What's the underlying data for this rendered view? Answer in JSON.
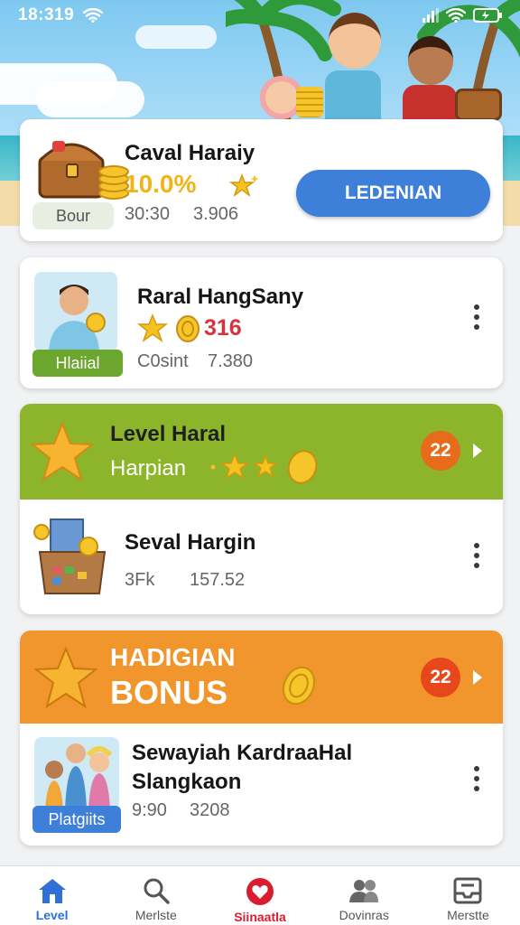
{
  "status_bar": {
    "time": "18:319"
  },
  "card1": {
    "title": "Caval Haraiy",
    "percent": "10.0%",
    "chip": "Bour",
    "meta_a": "30:30",
    "meta_b": "3.906",
    "button": "LEDENIAN"
  },
  "card2": {
    "title": "Raral HangSany",
    "number": "316",
    "chip": "Hlaiial",
    "meta_a": "C0sint",
    "meta_b": "7.380"
  },
  "card3": {
    "banner_title": "Level Haral",
    "banner_sub": "Harpian",
    "badge": "22",
    "item_title": "Seval Hargin",
    "meta_a": "3Fk",
    "meta_b": "157.52"
  },
  "card4": {
    "banner_line1": "HADIGIAN",
    "banner_line2": "BONUS",
    "badge": "22",
    "item_title_1": "Sewayiah KardraaHal",
    "item_title_2": "Slangkaon",
    "chip": "Platgiits",
    "meta_a": "9:90",
    "meta_b": "3208"
  },
  "tabs": [
    {
      "label": "Level",
      "color": "#2f6fd6"
    },
    {
      "label": "Merlste",
      "color": "#555555"
    },
    {
      "label": "Siinaatla",
      "color": "#d81e2e"
    },
    {
      "label": "Dovinras",
      "color": "#555555"
    },
    {
      "label": "Merstte",
      "color": "#555555"
    }
  ],
  "colors": {
    "accent_blue": "#3d7fd9",
    "green_banner": "#8db52c",
    "orange_banner": "#f0962d",
    "gold": "#f2b316",
    "red_number": "#d8333a"
  }
}
